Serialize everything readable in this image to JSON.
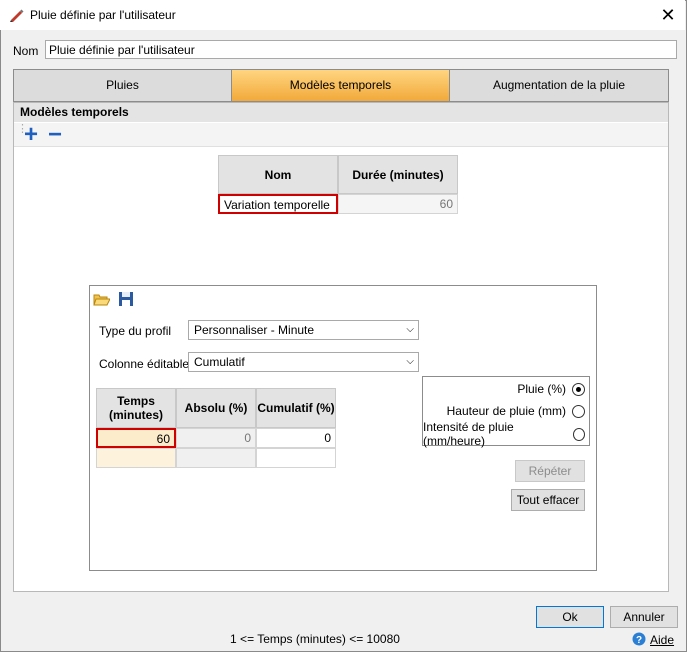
{
  "window": {
    "title": "Pluie définie par l'utilisateur",
    "close_symbol": "✕"
  },
  "name_field": {
    "label": "Nom",
    "value": "Pluie définie par l'utilisateur"
  },
  "tabs": [
    {
      "label": "Pluies",
      "active": false
    },
    {
      "label": "Modèles temporels",
      "active": true
    },
    {
      "label": "Augmentation de la pluie",
      "active": false
    }
  ],
  "section": {
    "title": "Modèles temporels"
  },
  "toolbar": {
    "add_symbol": "+",
    "remove_symbol": "−"
  },
  "models_grid": {
    "headers": [
      "Nom",
      "Durée (minutes)"
    ],
    "rows": [
      {
        "name": "Variation temporelle",
        "duration": "60"
      }
    ]
  },
  "profile": {
    "type_label": "Type du profil",
    "type_value": "Personnaliser - Minute",
    "column_label": "Colonne éditable",
    "column_value": "Cumulatif",
    "grid_headers": [
      "Temps (minutes)",
      "Absolu (%)",
      "Cumulatif (%)"
    ],
    "grid_rows": [
      {
        "time": "60",
        "absolute": "0",
        "cumulative": "0"
      }
    ]
  },
  "radios": [
    {
      "label": "Pluie (%)",
      "checked": true
    },
    {
      "label": "Hauteur de pluie (mm)",
      "checked": false
    },
    {
      "label": "Intensité de pluie (mm/heure)",
      "checked": false
    }
  ],
  "buttons": {
    "repeat": "Répéter",
    "clear_all": "Tout effacer",
    "ok": "Ok",
    "cancel": "Annuler"
  },
  "status": {
    "constraint": "1 <= Temps (minutes) <= 10080",
    "help": "Aide"
  },
  "colors": {
    "active_tab": "#f2a93a",
    "selection_border": "#d00000",
    "add_icon": "#1f5fbf",
    "help_icon": "#2a7fd4"
  }
}
